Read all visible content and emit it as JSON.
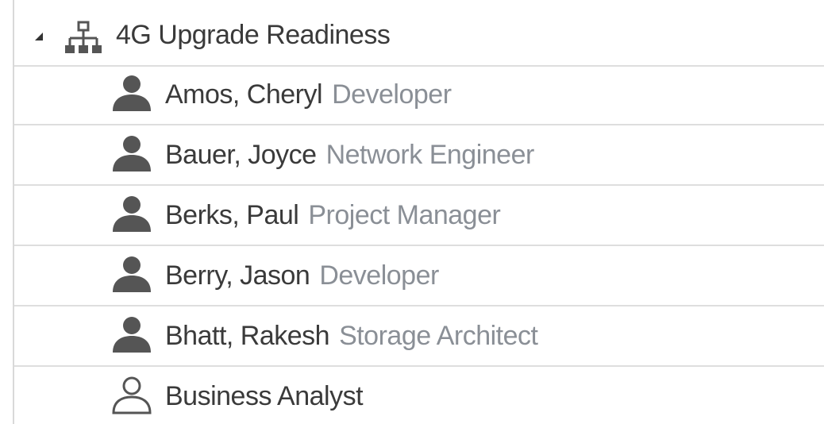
{
  "group": {
    "label": "4G Upgrade Readiness",
    "icon": "org-chart-icon"
  },
  "members": [
    {
      "name": "Amos, Cheryl",
      "role": "Developer",
      "icon": "person-filled-icon"
    },
    {
      "name": "Bauer, Joyce",
      "role": "Network Engineer",
      "icon": "person-filled-icon"
    },
    {
      "name": "Berks, Paul",
      "role": "Project Manager",
      "icon": "person-filled-icon"
    },
    {
      "name": "Berry, Jason",
      "role": "Developer",
      "icon": "person-filled-icon"
    },
    {
      "name": "Bhatt, Rakesh",
      "role": "Storage Architect",
      "icon": "person-filled-icon"
    },
    {
      "name": "Business Analyst",
      "role": "",
      "icon": "person-outline-icon"
    }
  ],
  "colors": {
    "text": "#3a3a3a",
    "role_text": "#8a8f96",
    "icon": "#555555",
    "divider": "#dedede"
  }
}
